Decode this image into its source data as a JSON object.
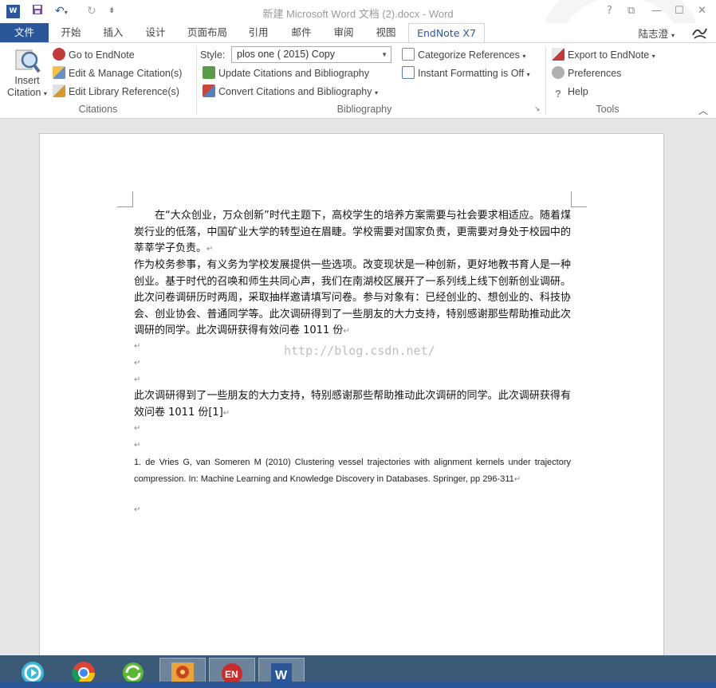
{
  "app": {
    "window_title": "新建 Microsoft Word 文档 (2).docx - Word",
    "logo_text": "W",
    "qat": {
      "undo": "↶",
      "undo_arrow": "▾",
      "redo": "↻",
      "customize": "⇟"
    },
    "window_controls": {
      "help": "?",
      "restore": "⧉",
      "minimize": "—",
      "maximize": "☐",
      "close": "✕"
    }
  },
  "tabs": [
    {
      "label": "文件"
    },
    {
      "label": "开始"
    },
    {
      "label": "插入"
    },
    {
      "label": "设计"
    },
    {
      "label": "页面布局"
    },
    {
      "label": "引用"
    },
    {
      "label": "邮件"
    },
    {
      "label": "审阅"
    },
    {
      "label": "视图"
    },
    {
      "label": "EndNote X7"
    }
  ],
  "user": {
    "name": "陆志澄",
    "arrow": "▾"
  },
  "ribbon": {
    "insert_citation": {
      "label_line1": "Insert",
      "label_line2": "Citation",
      "arrow": "▾"
    },
    "citations_group": {
      "go_to_endnote": "Go to EndNote",
      "edit_manage": "Edit & Manage Citation(s)",
      "edit_library": "Edit Library Reference(s)",
      "label": "Citations"
    },
    "bibliography_group": {
      "style_label": "Style:",
      "style_value": "plos one ( 2015) Copy",
      "update": "Update Citations and Bibliography",
      "convert": "Convert Citations and Bibliography",
      "convert_arrow": "▾",
      "categorize": "Categorize References",
      "categorize_arrow": "▾",
      "instant": "Instant Formatting is Off",
      "instant_arrow": "▾",
      "label": "Bibliography",
      "launcher": "↘"
    },
    "tools_group": {
      "export": "Export to EndNote",
      "export_arrow": "▾",
      "preferences": "Preferences",
      "help": "Help",
      "label": "Tools"
    },
    "collapse": "︿"
  },
  "document": {
    "para1": "在“大众创业，万众创新”时代主题下，高校学生的培养方案需要与社会要求相适应。随着煤炭行业的低落，中国矿业大学的转型迫在眉睫。学校需要对国家负责，更需要对身处于校园中的莘莘学子负责。",
    "para2": "作为校务参事，有义务为学校发展提供一些选项。改变现状是一种创新，更好地教书育人是一种创业。基于时代的召唤和师生共同心声，我们在南湖校区展开了一系列线上线下创新创业调研。此次问卷调研历时两周，采取抽样邀请填写问卷。参与对象有：已经创业的、想创业的、科技协会、创业协会、普通同学等。此次调研得到了一些朋友的大力支持，特别感谢那些帮助推动此次调研的同学。此次调研获得有效问卷 1011 份",
    "para3": "此次调研得到了一些朋友的大力支持，特别感谢那些帮助推动此次调研的同学。此次调研获得有效问卷 1011 份[1]",
    "reference": "1. de Vries G, van Someren M (2010) Clustering vessel trajectories with alignment kernels under trajectory compression. In:   Machine Learning and Knowledge Discovery in Databases. Springer, pp 296-311",
    "para_mark": "↵",
    "watermark": "http://blog.csdn.net/"
  }
}
